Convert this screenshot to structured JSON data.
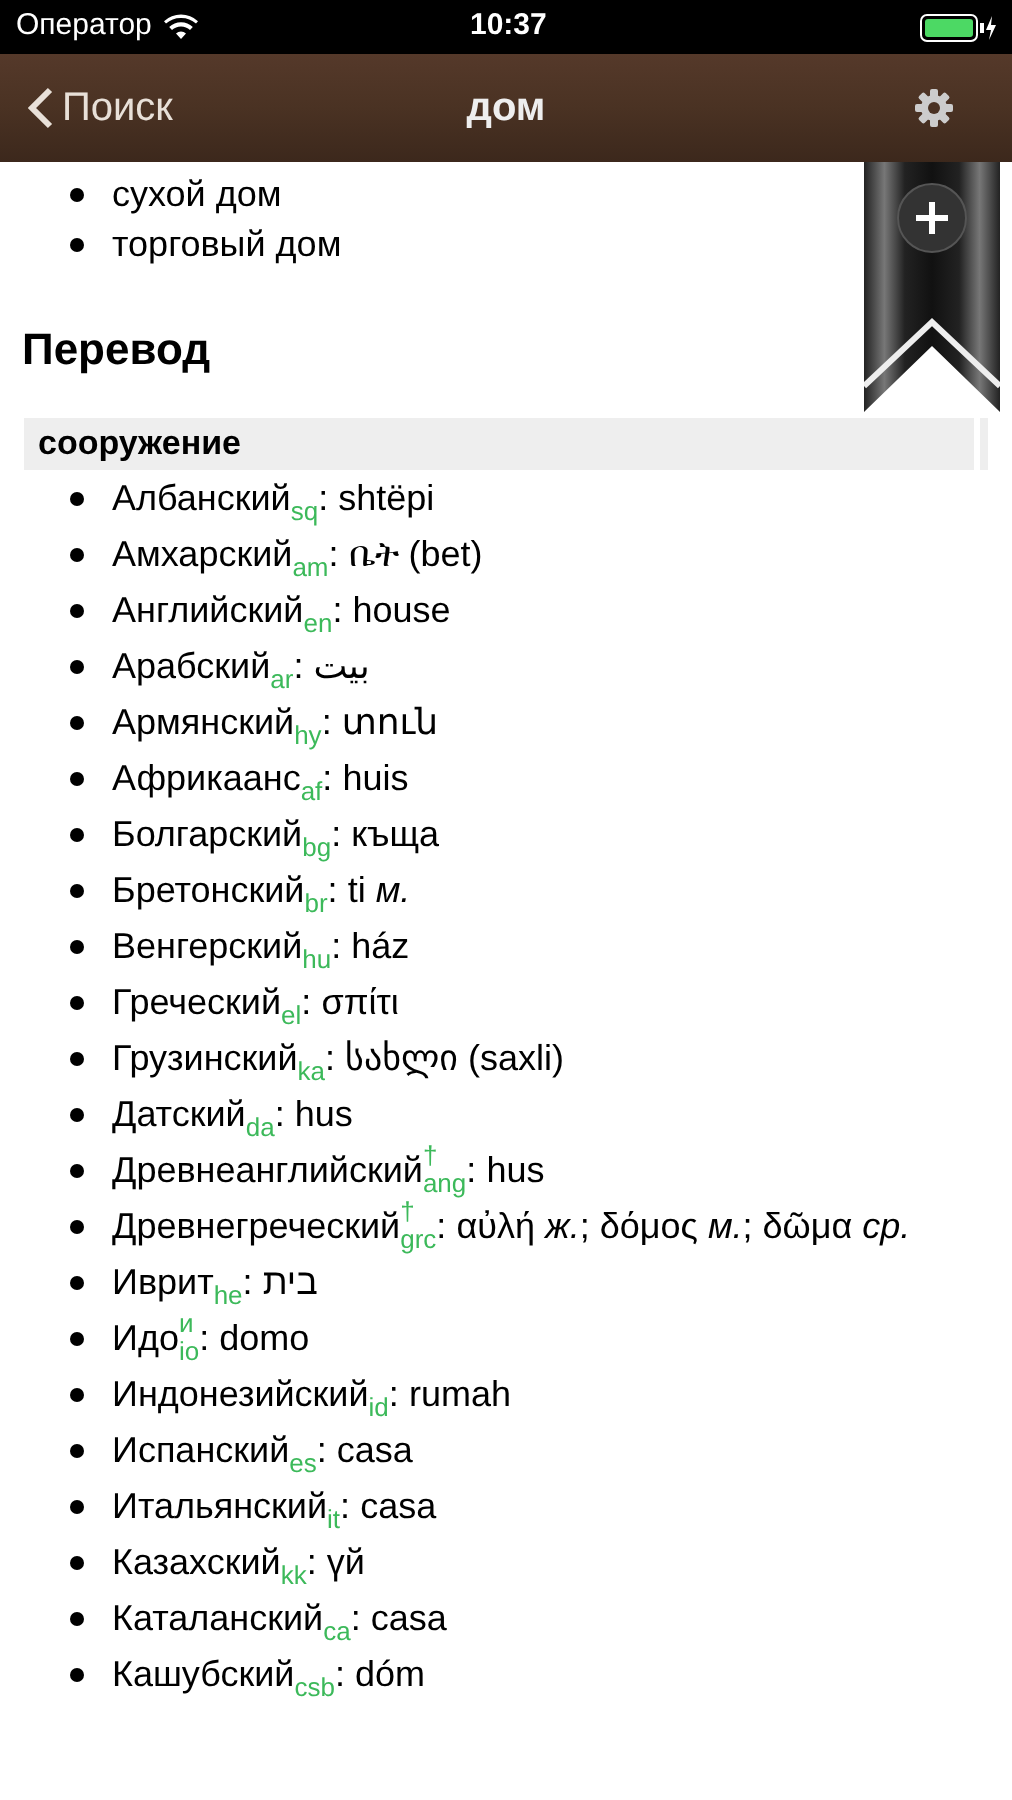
{
  "status_bar": {
    "carrier": "Оператор",
    "time": "10:37"
  },
  "nav_bar": {
    "back": "Поиск",
    "title": "дом"
  },
  "related": [
    "сухой дом",
    "торговый дом"
  ],
  "heading": "Перевод",
  "group": {
    "title": "сооружение",
    "separator": ":",
    "translations": [
      {
        "language": "Албанский",
        "code": "sq",
        "text": "shtëpi"
      },
      {
        "language": "Амхарский",
        "code": "am",
        "text": "ቤት (bet)"
      },
      {
        "language": "Английский",
        "code": "en",
        "text": "house"
      },
      {
        "language": "Арабский",
        "code": "ar",
        "text": "بيت"
      },
      {
        "language": "Армянский",
        "code": "hy",
        "text": "տուն"
      },
      {
        "language": "Африкаанс",
        "code": "af",
        "text": "huis"
      },
      {
        "language": "Болгарский",
        "code": "bg",
        "text": "къща"
      },
      {
        "language": "Бретонский",
        "code": "br",
        "text": "ti *м.*"
      },
      {
        "language": "Венгерский",
        "code": "hu",
        "text": "ház"
      },
      {
        "language": "Греческий",
        "code": "el",
        "text": "σπίτι"
      },
      {
        "language": "Грузинский",
        "code": "ka",
        "text": "სახლი (saxli)"
      },
      {
        "language": "Датский",
        "code": "da",
        "text": "hus"
      },
      {
        "language": "Древнеанглийский",
        "mark": "†",
        "code": "ang",
        "text": "hus"
      },
      {
        "language": "Древнегреческий",
        "mark": "†",
        "code": "grc",
        "text": "αὐλή *ж.*; δόμος *м.*; δῶμα *ср.*"
      },
      {
        "language": "Иврит",
        "code": "he",
        "text": "בית"
      },
      {
        "language": "Идо",
        "mark": "и",
        "code": "io",
        "text": "domo"
      },
      {
        "language": "Индонезийский",
        "code": "id",
        "text": "rumah"
      },
      {
        "language": "Испанский",
        "code": "es",
        "text": "casa"
      },
      {
        "language": "Итальянский",
        "code": "it",
        "text": "casa"
      },
      {
        "language": "Казахский",
        "code": "kk",
        "text": "үй"
      },
      {
        "language": "Каталанский",
        "code": "ca",
        "text": "casa"
      },
      {
        "language": "Кашубский",
        "code": "csb",
        "text": "dóm"
      }
    ]
  }
}
